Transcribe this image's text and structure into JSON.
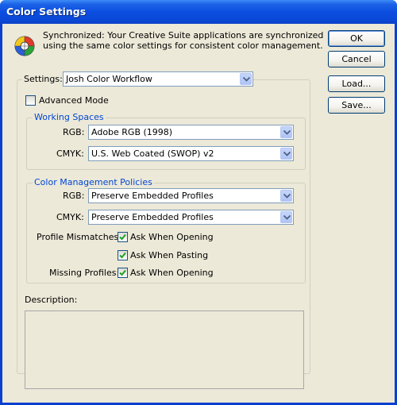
{
  "window": {
    "title": "Color Settings"
  },
  "sync_message": {
    "line1": "Synchronized: Your Creative Suite applications are synchronized",
    "line2": "using the same color settings for consistent color management."
  },
  "buttons": {
    "ok": "OK",
    "cancel": "Cancel",
    "load": "Load...",
    "save": "Save..."
  },
  "settings": {
    "label": "Settings:",
    "value": "Josh Color Workflow"
  },
  "advanced_mode": {
    "label": "Advanced Mode",
    "checked": false
  },
  "working_spaces": {
    "title": "Working Spaces",
    "rgb_label": "RGB:",
    "rgb_value": "Adobe RGB (1998)",
    "cmyk_label": "CMYK:",
    "cmyk_value": "U.S. Web Coated (SWOP) v2"
  },
  "policies": {
    "title": "Color Management Policies",
    "rgb_label": "RGB:",
    "rgb_value": "Preserve Embedded Profiles",
    "cmyk_label": "CMYK:",
    "cmyk_value": "Preserve Embedded Profiles",
    "profile_mismatches_label": "Profile Mismatches:",
    "ask_opening": "Ask When Opening",
    "ask_pasting": "Ask When Pasting",
    "missing_profiles_label": "Missing Profiles:",
    "missing_ask_opening": "Ask When Opening"
  },
  "description": {
    "label": "Description:"
  },
  "icons": {
    "sync": "color-wheel-icon",
    "dropdown": "chevron-down-icon",
    "check": "checkmark-icon"
  },
  "colors": {
    "title_bar": "#0b4ee0",
    "dialog_bg": "#ece9d8",
    "group_title": "#0046d5"
  }
}
